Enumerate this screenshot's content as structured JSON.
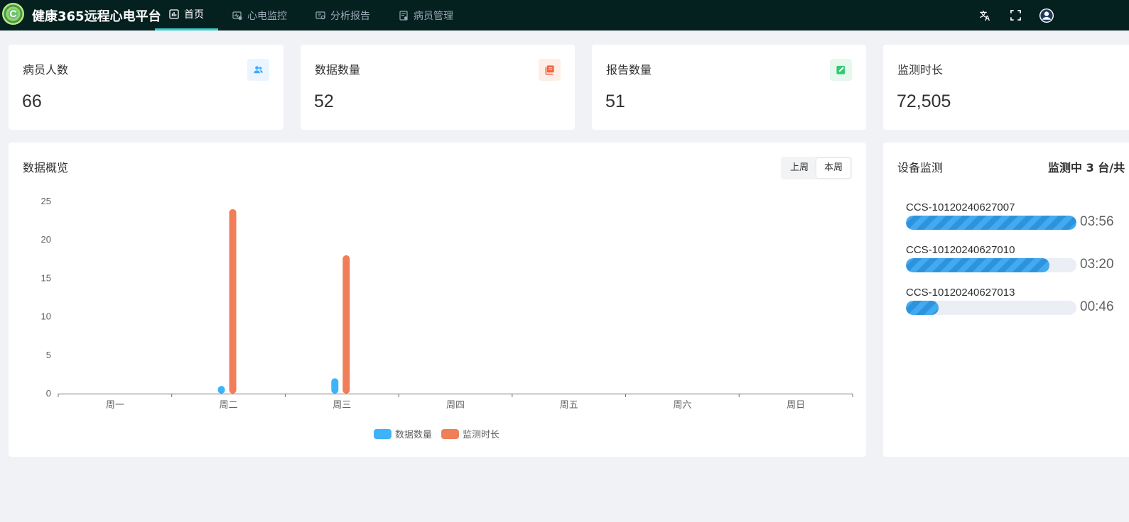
{
  "header": {
    "brand": "健康365远程心电平台",
    "nav": [
      {
        "label": "首页",
        "icon": "dashboard-icon",
        "active": true
      },
      {
        "label": "心电监控",
        "icon": "monitor-icon",
        "active": false
      },
      {
        "label": "分析报告",
        "icon": "report-icon",
        "active": false
      },
      {
        "label": "病员管理",
        "icon": "patient-list-icon",
        "active": false
      }
    ],
    "icons": [
      "translate-icon",
      "fullscreen-icon",
      "user-avatar-icon"
    ]
  },
  "stats": [
    {
      "title": "病员人数",
      "value": "66",
      "icon": "users-icon",
      "color": "#40a9ff"
    },
    {
      "title": "数据数量",
      "value": "52",
      "icon": "layers-icon",
      "color": "#f0643c"
    },
    {
      "title": "报告数量",
      "value": "51",
      "icon": "edit-icon",
      "color": "#2ecc71"
    },
    {
      "title": "监测时长",
      "value": "72,505"
    }
  ],
  "overview": {
    "title": "数据概览",
    "tabs": [
      {
        "label": "上周",
        "active": false
      },
      {
        "label": "本周",
        "active": true
      }
    ]
  },
  "chart_data": {
    "type": "bar",
    "categories": [
      "周一",
      "周二",
      "周三",
      "周四",
      "周五",
      "周六",
      "周日"
    ],
    "series": [
      {
        "name": "数据数量",
        "values": [
          0,
          1,
          2,
          0,
          0,
          0,
          0
        ],
        "color": "#3eb3f7"
      },
      {
        "name": "监测时长",
        "values": [
          0,
          24,
          18,
          0,
          0,
          0,
          0
        ],
        "color": "#f07f59"
      }
    ],
    "yticks": [
      "0",
      "5",
      "10",
      "15",
      "20",
      "25"
    ],
    "ylim": [
      0,
      25
    ],
    "legend": "bottom-center"
  },
  "devices": {
    "title": "设备监测",
    "count_text": "监测中 3 台/共",
    "items": [
      {
        "name": "CCS-10120240627007",
        "time": "03:56",
        "progress": 1.0
      },
      {
        "name": "CCS-10120240627010",
        "time": "03:20",
        "progress": 0.84
      },
      {
        "name": "CCS-10120240627013",
        "time": "00:46",
        "progress": 0.19
      }
    ]
  }
}
